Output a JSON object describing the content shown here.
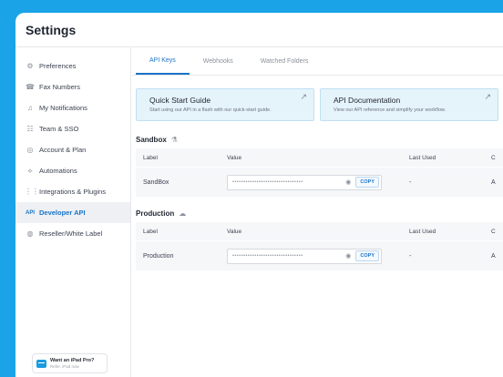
{
  "header": {
    "title": "Settings"
  },
  "sidebar": {
    "items": [
      {
        "label": "Preferences",
        "icon": "gear-icon",
        "glyph": "⚙"
      },
      {
        "label": "Fax Numbers",
        "icon": "fax-icon",
        "glyph": "☎"
      },
      {
        "label": "My Notifications",
        "icon": "bell-icon",
        "glyph": "♫"
      },
      {
        "label": "Team & SSO",
        "icon": "team-icon",
        "glyph": "☷"
      },
      {
        "label": "Account & Plan",
        "icon": "account-icon",
        "glyph": "◎"
      },
      {
        "label": "Automations",
        "icon": "automation-icon",
        "glyph": "⟡"
      },
      {
        "label": "Integrations & Plugins",
        "icon": "grid-icon",
        "glyph": "⋮⋮"
      },
      {
        "label": "Developer API",
        "icon": "api-icon",
        "glyph": "API"
      },
      {
        "label": "Reseller/White Label",
        "icon": "globe-icon",
        "glyph": "◍"
      }
    ],
    "active_index": 7,
    "promo": {
      "title": "Want an iPad Pro?",
      "subtitle": "Refer. iPad now"
    }
  },
  "tabs": [
    {
      "label": "API Keys",
      "active": true
    },
    {
      "label": "Webhooks",
      "active": false
    },
    {
      "label": "Watched Folders",
      "active": false
    }
  ],
  "cards": [
    {
      "title": "Quick Start Guide",
      "desc": "Start using our API in a flash with our quick-start guide."
    },
    {
      "title": "API Documentation",
      "desc": "View our API reference and simplify your workflow."
    }
  ],
  "columns": {
    "label": "Label",
    "value": "Value",
    "last_used": "Last Used",
    "truncated": "C"
  },
  "sandbox": {
    "title": "Sandbox",
    "row": {
      "label": "SandBox",
      "mask": "••••••••••••••••••••••••••••••••",
      "copy": "COPY",
      "last_used": "-",
      "truncated": "A"
    }
  },
  "production": {
    "title": "Production",
    "row": {
      "label": "Production",
      "mask": "••••••••••••••••••••••••••••••••",
      "copy": "COPY",
      "last_used": "-",
      "truncated": "A"
    }
  },
  "colors": {
    "accent": "#1a73c8",
    "background": "#1aa3e6",
    "card": "#e5f3fb"
  }
}
